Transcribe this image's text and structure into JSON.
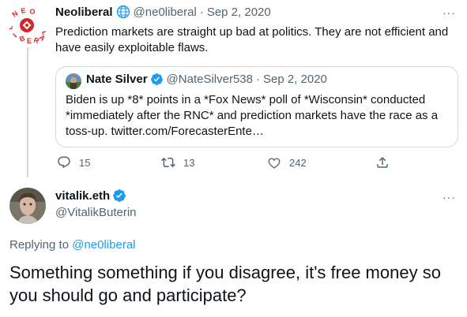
{
  "tweet": {
    "author_name": "Neoliberal",
    "author_handle": "@ne0liberal",
    "separator": "·",
    "date": "Sep 2, 2020",
    "more": "···",
    "text": "Prediction markets are straight up bad at politics. They are not efficient and have easily exploitable flaws."
  },
  "quote": {
    "author_name": "Nate Silver",
    "author_handle": "@NateSilver538",
    "separator": "·",
    "date": "Sep 2, 2020",
    "text": "Biden is up *8* points in a *Fox News* poll of *Wisconsin* conducted *immediately after the RNC* and prediction markets have the race as a toss-up. twitter.com/ForecasterEnte…"
  },
  "actions": {
    "reply_count": "15",
    "retweet_count": "13",
    "like_count": "242"
  },
  "reply": {
    "author_name": "vitalik.eth",
    "author_handle": "@VitalikButerin",
    "more": "···",
    "replying_prefix": "Replying to",
    "replying_handle": "@ne0liberal",
    "text": "Something something if you disagree, it's free money so you should go and participate?"
  },
  "icons": {
    "globe": "globe-icon",
    "verified": "verified-badge-icon",
    "reply": "reply-icon",
    "retweet": "retweet-icon",
    "like": "heart-icon",
    "share": "share-icon"
  },
  "colors": {
    "link": "#1d9bf0",
    "muted": "#536471",
    "border": "#cfd9de",
    "logo_red": "#d7262a"
  }
}
